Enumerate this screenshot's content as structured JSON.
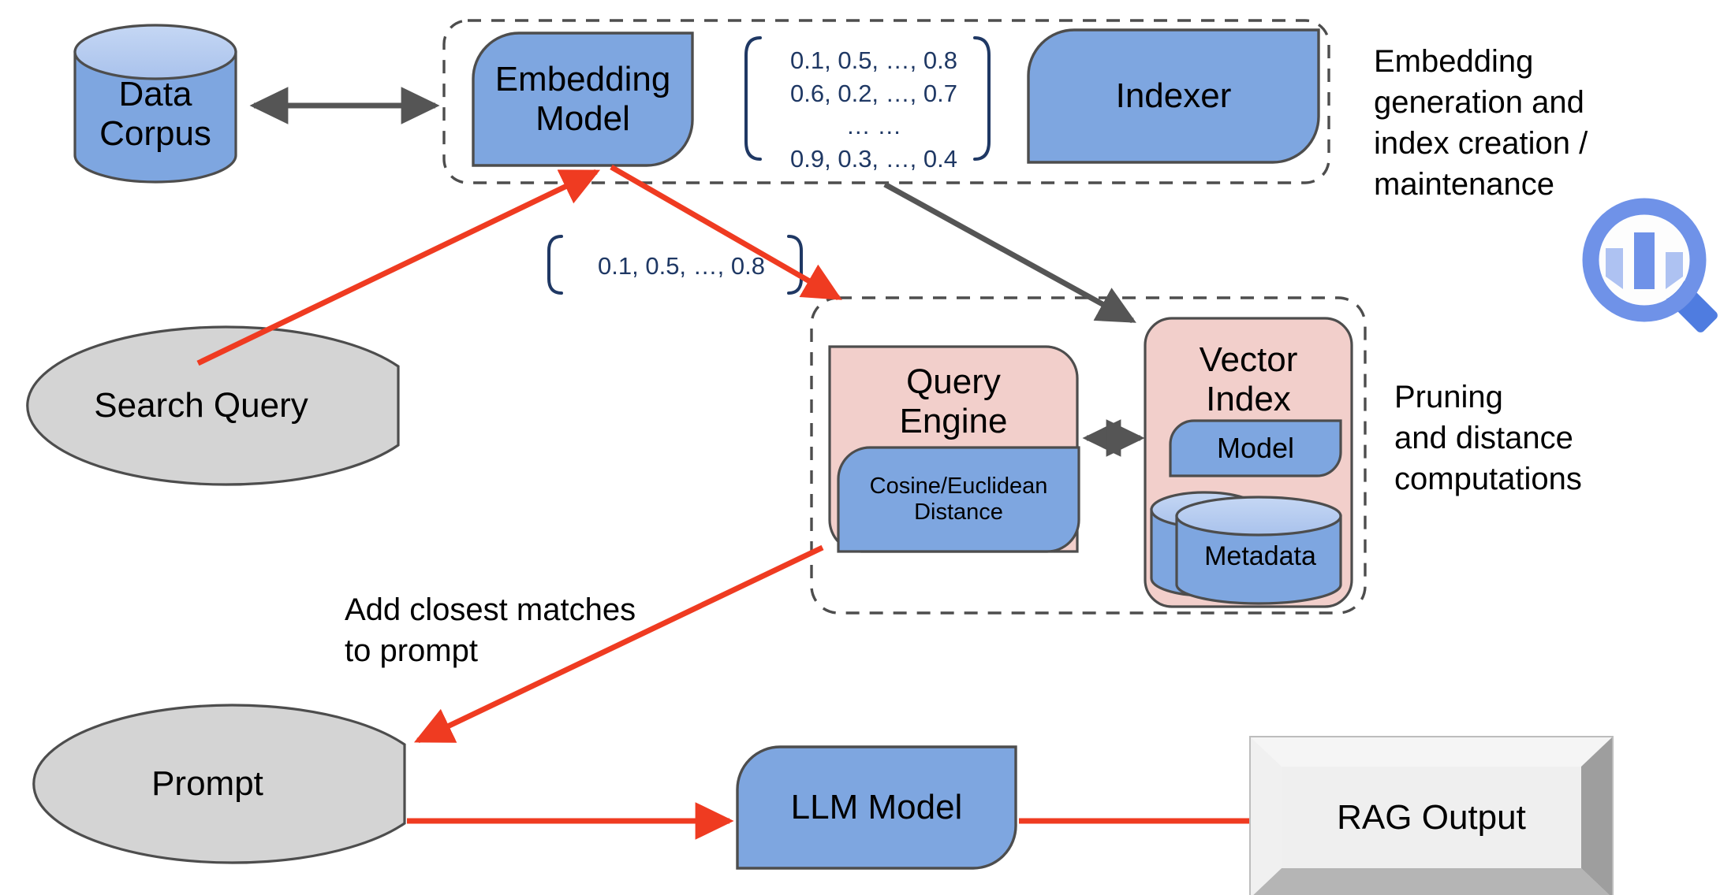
{
  "diagram": {
    "title": "RAG retrieval architecture",
    "colors": {
      "blue_fill": "#7ea6e0",
      "blue_top": "#afc9ee",
      "pink_fill": "#f2cfcb",
      "gray_fill": "#d4d4d4",
      "outline": "#4d4d4d",
      "red_arrow": "#ef3b21",
      "gray_arrow": "#555555",
      "navy_text": "#1f3864",
      "output_fill": "#eeeeee",
      "logo_blue": "#6f92e8",
      "logo_blue_light": "#aec2f2"
    },
    "nodes": {
      "data_corpus": {
        "label": "Data\nCorpus",
        "shape": "cylinder"
      },
      "embedding_model": {
        "label": "Embedding\nModel",
        "shape": "process-rounded"
      },
      "indexer": {
        "label": "Indexer",
        "shape": "process-rounded"
      },
      "query_engine": {
        "label": "Query\nEngine",
        "shape": "process-rounded-pink"
      },
      "distance": {
        "label": "Cosine/Euclidean\nDistance",
        "shape": "process-rounded"
      },
      "vector_index": {
        "label": "Vector\nIndex",
        "shape": "rounded-pink"
      },
      "model": {
        "label": "Model",
        "shape": "process-rounded"
      },
      "metadata": {
        "label": "Metadata",
        "shape": "double-cylinder"
      },
      "search_query": {
        "label": "Search Query",
        "shape": "delay"
      },
      "prompt": {
        "label": "Prompt",
        "shape": "delay"
      },
      "llm_model": {
        "label": "LLM Model",
        "shape": "process-rounded"
      },
      "rag_output": {
        "label": "RAG Output",
        "shape": "3d-box"
      }
    },
    "matrices": {
      "corpus_embeddings": "0.1, 0.5, …, 0.8\n0.6, 0.2, …,  0.7\n… …\n0.9, 0.3, …,  0.4",
      "query_embedding": "0.1, 0.5, …,  0.8"
    },
    "annotations": {
      "top_group_caption": "Embedding\ngeneration and\nindex creation /\nmaintenance",
      "bottom_group_caption": "Pruning\nand distance\ncomputations",
      "prompt_edge_caption": "Add closest matches\nto prompt"
    },
    "icons": {
      "search_analytics_logo": "search-chart-icon"
    }
  }
}
